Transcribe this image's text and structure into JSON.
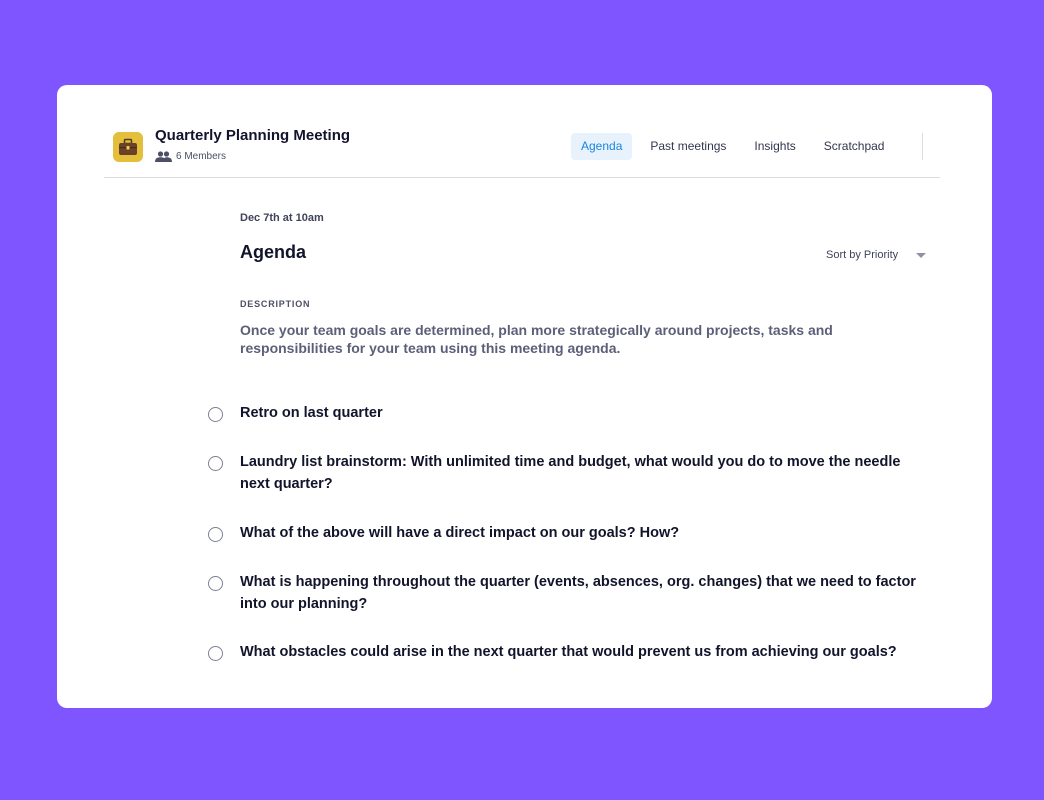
{
  "header": {
    "app_icon": "briefcase-icon",
    "title": "Quarterly Planning Meeting",
    "members_icon": "people-icon",
    "members_label": "6 Members",
    "tabs": [
      {
        "label": "Agenda",
        "active": true
      },
      {
        "label": "Past meetings",
        "active": false
      },
      {
        "label": "Insights",
        "active": false
      },
      {
        "label": "Scratchpad",
        "active": false
      }
    ]
  },
  "main": {
    "date": "Dec 7th at 10am",
    "title": "Agenda",
    "sort_label": "Sort by Priority",
    "description_label": "DESCRIPTION",
    "description": "Once your team goals are determined, plan more strategically around projects, tasks and responsibilities for your team using this meeting agenda.",
    "items": [
      {
        "text": "Retro on last quarter",
        "checked": false
      },
      {
        "text": "Laundry list brainstorm: With unlimited time and budget, what would you do to move the needle next quarter?",
        "checked": false
      },
      {
        "text": "What of the above will have a direct impact on our goals? How?",
        "checked": false
      },
      {
        "text": "What is happening throughout the quarter (events, absences, org. changes) that we need to factor into our planning?",
        "checked": false
      },
      {
        "text": "What obstacles could arise in the next quarter that would prevent us from achieving our goals?",
        "checked": false
      }
    ]
  },
  "colors": {
    "background": "#7f55ff",
    "accent": "#1b84dc",
    "active_tab_bg": "#e7f2fd",
    "icon_bg": "#e4bf3c"
  }
}
